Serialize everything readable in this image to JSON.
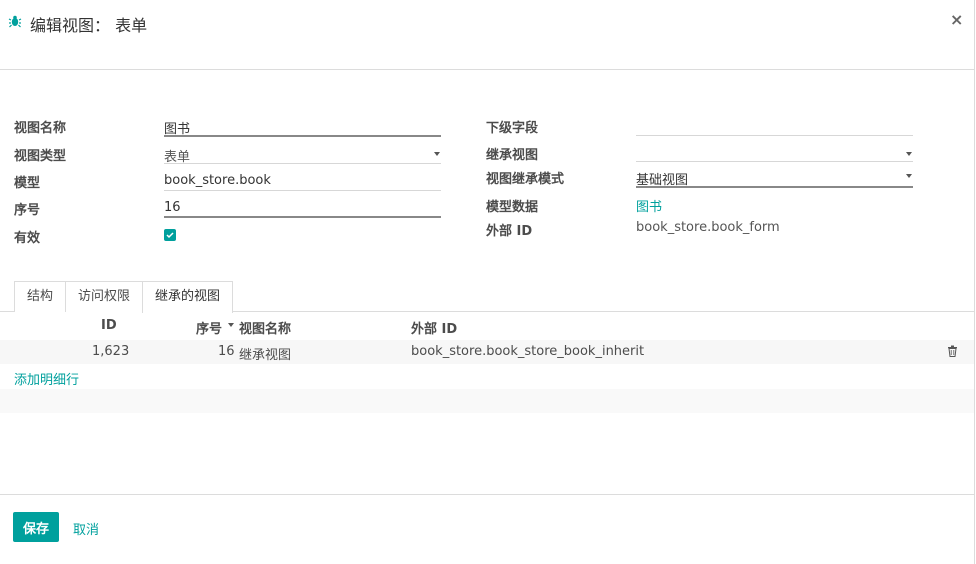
{
  "dialog": {
    "title": "编辑视图： 表单",
    "close_glyph": "×"
  },
  "form": {
    "left": [
      {
        "label": "视图名称",
        "value": "图书"
      },
      {
        "label": "视图类型",
        "value": "表单"
      },
      {
        "label": "模型",
        "value": "book_store.book"
      },
      {
        "label": "序号",
        "value": "16"
      },
      {
        "label": "有效",
        "checked": true
      }
    ],
    "right": [
      {
        "label": "下级字段",
        "value": ""
      },
      {
        "label": "继承视图",
        "value": ""
      },
      {
        "label": "视图继承模式",
        "value": "基础视图"
      },
      {
        "label": "模型数据",
        "value": "图书"
      },
      {
        "label": "外部 ID",
        "value": "book_store.book_form"
      }
    ]
  },
  "tabs": [
    {
      "label": "结构",
      "active": false
    },
    {
      "label": "访问权限",
      "active": false
    },
    {
      "label": "继承的视图",
      "active": true
    }
  ],
  "table": {
    "headers": [
      "ID",
      "序号",
      "视图名称",
      "外部 ID"
    ],
    "sort_column": "序号",
    "rows": [
      {
        "id": "1,623",
        "sequence": "16",
        "name": "继承视图",
        "external_id": "book_store.book_store_book_inherit"
      }
    ],
    "add_line_label": "添加明细行"
  },
  "footer": {
    "save_label": "保存",
    "cancel_label": "取消"
  },
  "colors": {
    "accent": "#00a09d",
    "text": "#4c4c4c",
    "border": "#dcdcdc"
  },
  "icons": {
    "header": "bug-icon",
    "close": "close-icon",
    "delete": "trash-icon",
    "sort": "sort-desc-icon",
    "dropdown": "caret-down-icon"
  }
}
